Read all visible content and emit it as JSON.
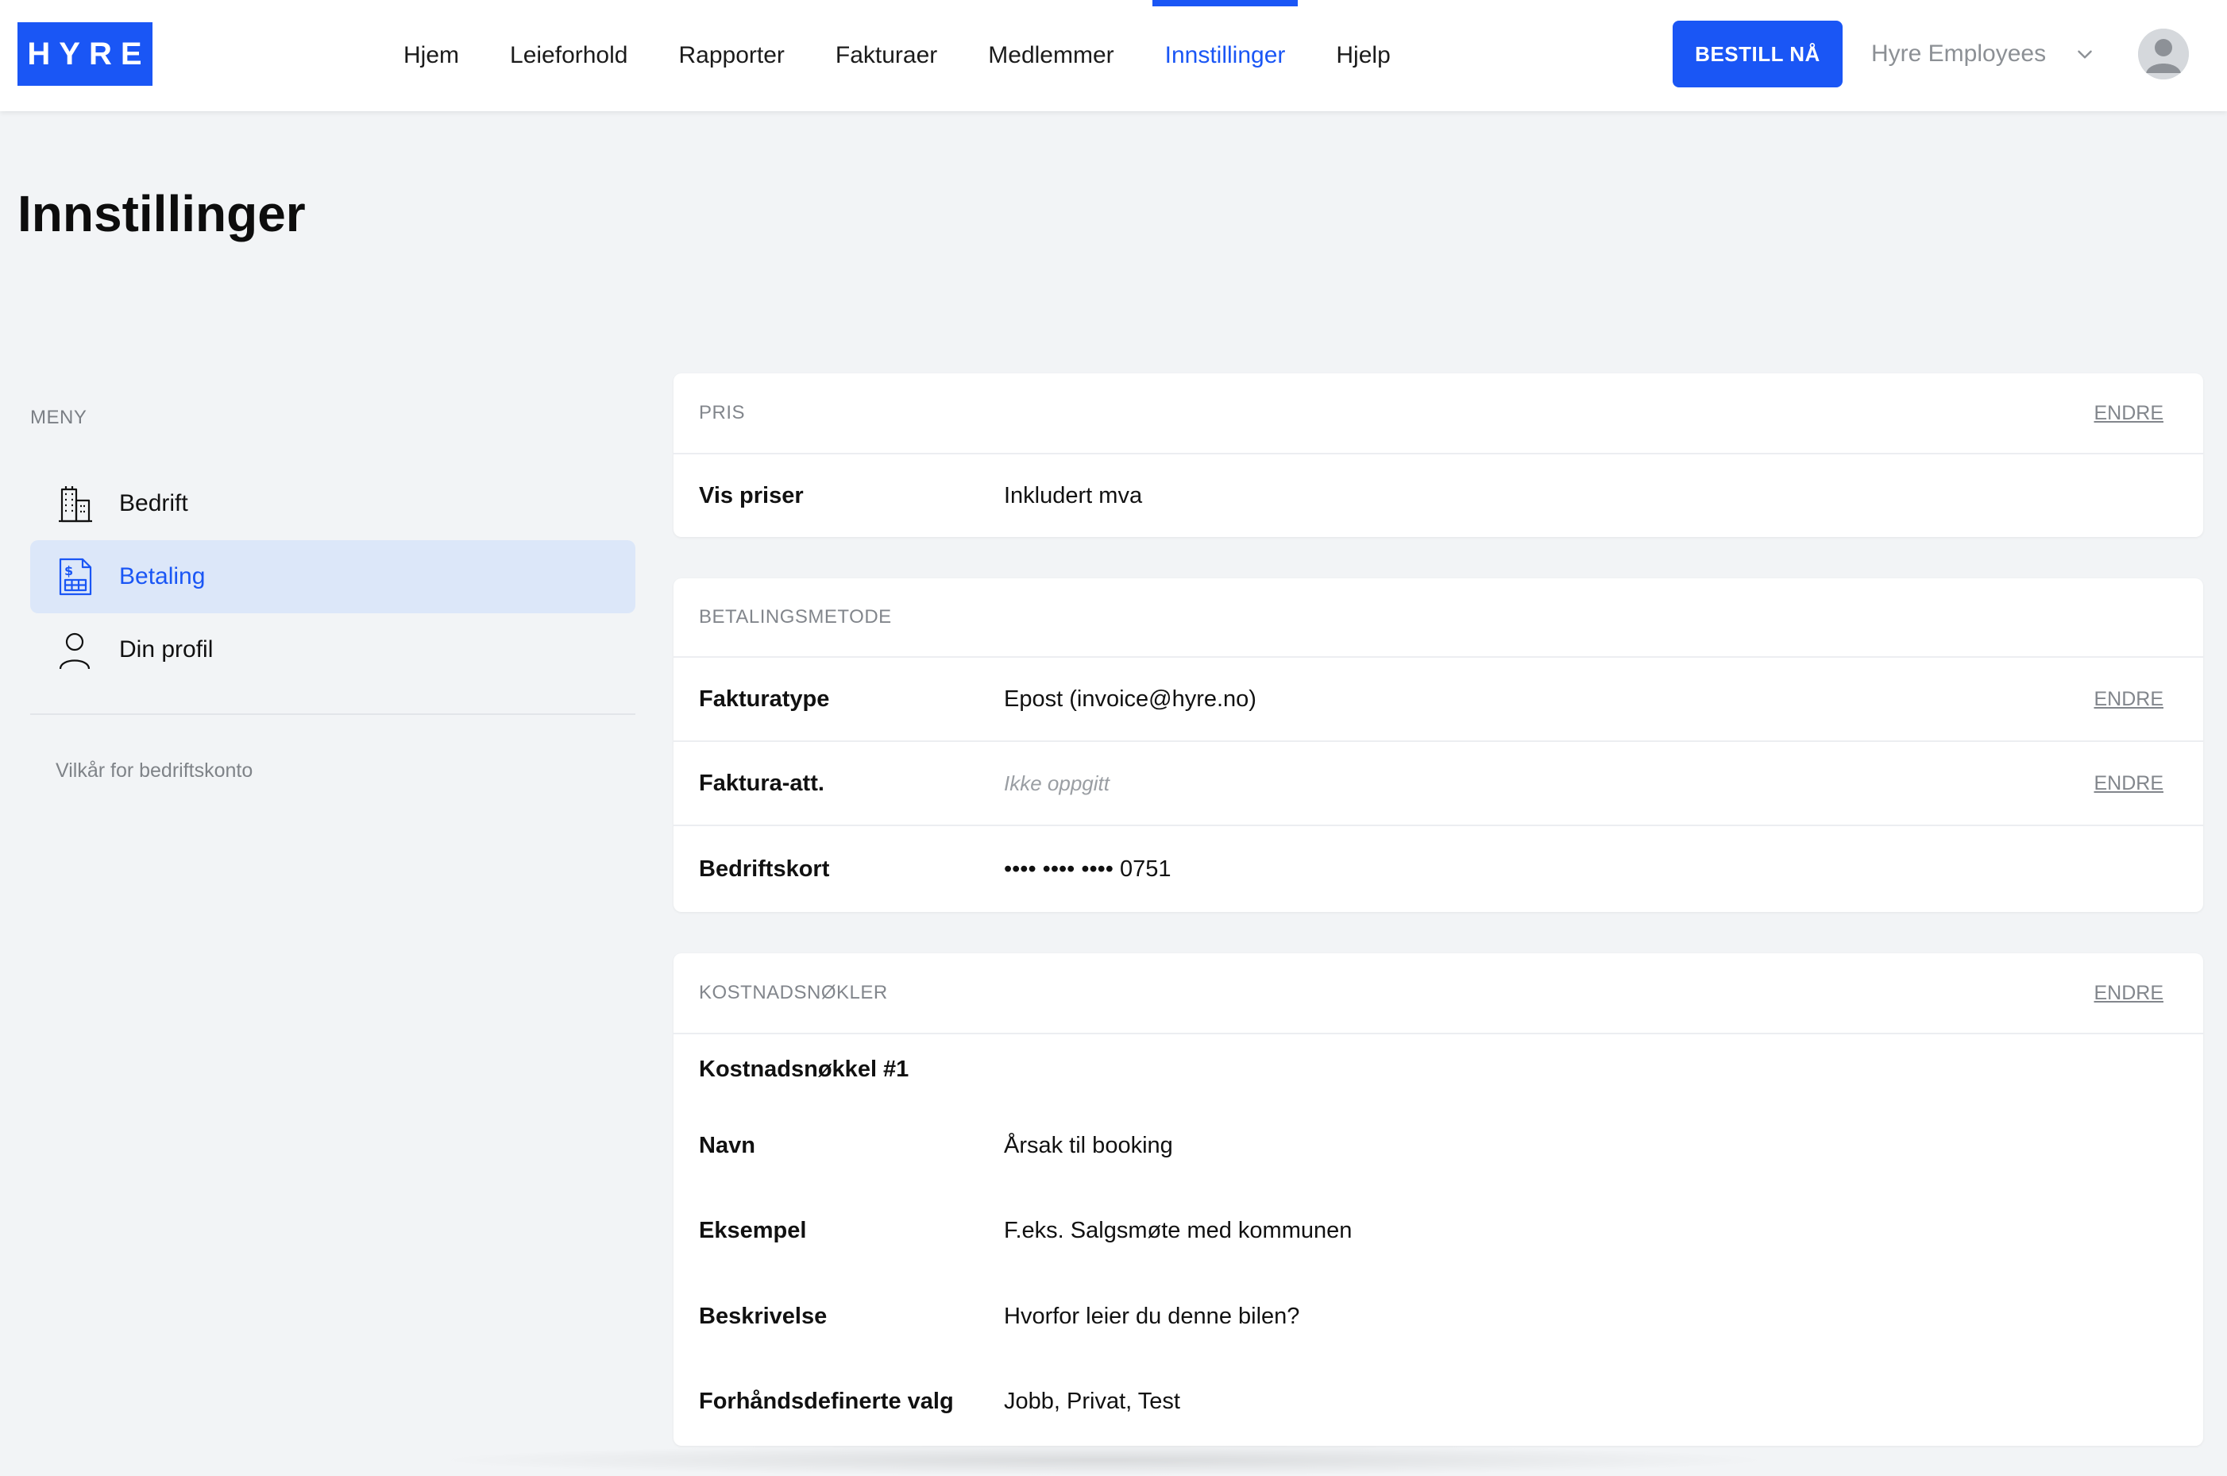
{
  "brand": {
    "logo_text": "HYRE",
    "accent": "#1a56f5"
  },
  "nav": {
    "items": [
      {
        "label": "Hjem",
        "active": false
      },
      {
        "label": "Leieforhold",
        "active": false
      },
      {
        "label": "Rapporter",
        "active": false
      },
      {
        "label": "Fakturaer",
        "active": false
      },
      {
        "label": "Medlemmer",
        "active": false
      },
      {
        "label": "Innstillinger",
        "active": true
      },
      {
        "label": "Hjelp",
        "active": false
      }
    ],
    "order_button": "BESTILL NÅ",
    "org_switch": "Hyre Employees"
  },
  "page": {
    "title": "Innstillinger"
  },
  "sidebar": {
    "menu_label": "MENY",
    "items": [
      {
        "label": "Bedrift",
        "icon": "building-icon",
        "active": false
      },
      {
        "label": "Betaling",
        "icon": "payment-document-icon",
        "active": true
      },
      {
        "label": "Din profil",
        "icon": "user-icon",
        "active": false
      }
    ],
    "terms_link": "Vilkår for bedriftskonto"
  },
  "sections": {
    "price": {
      "title": "PRIS",
      "edit": "ENDRE",
      "rows": [
        {
          "label": "Vis priser",
          "value": "Inkludert mva"
        }
      ]
    },
    "payment": {
      "title": "BETALINGSMETODE",
      "rows": [
        {
          "label": "Fakturatype",
          "value": "Epost (invoice@hyre.no)",
          "edit": "ENDRE"
        },
        {
          "label": "Faktura-att.",
          "value": "Ikke oppgitt",
          "edit": "ENDRE"
        },
        {
          "label": "Bedriftskort",
          "value": "•••• •••• •••• 0751"
        }
      ]
    },
    "cost_keys": {
      "title": "KOSTNADSNØKLER",
      "edit": "ENDRE",
      "subheading": "Kostnadsnøkkel #1",
      "rows": [
        {
          "label": "Navn",
          "value": "Årsak til booking"
        },
        {
          "label": "Eksempel",
          "value": "F.eks. Salgsmøte med kommunen"
        },
        {
          "label": "Beskrivelse",
          "value": "Hvorfor leier du denne bilen?"
        },
        {
          "label": "Forhåndsdefinerte valg",
          "value": "Jobb, Privat, Test"
        }
      ]
    }
  }
}
